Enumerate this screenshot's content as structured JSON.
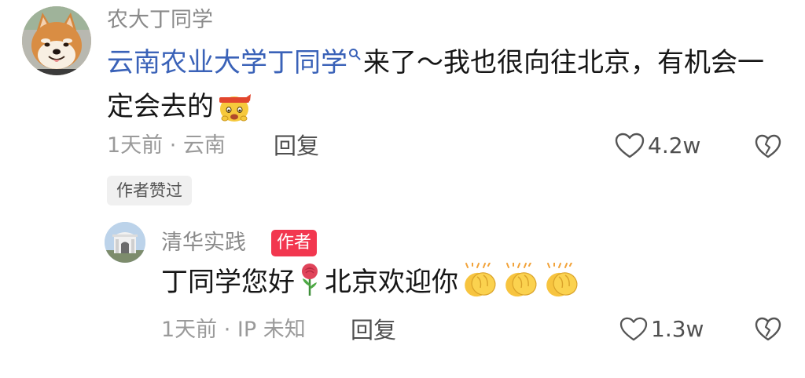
{
  "comment": {
    "username": "农大丁同学",
    "mention_name": "云南农业大学丁同学",
    "text_after_mention": "来了～我也很向往北京，有机会一定会去的",
    "emoji": "emoji-headband-face",
    "time": "1天前 · 云南",
    "reply_label": "回复",
    "like_count": "4.2w",
    "icons": {
      "like": "heart-outline-icon",
      "dislike": "broken-heart-icon",
      "mention": "search-icon"
    },
    "mention_color": "#3a62b8",
    "author_liked_badge": "作者赞过"
  },
  "reply": {
    "username": "清华实践",
    "author_tag": "作者",
    "author_tag_color": "#f2374f",
    "text_part1": "丁同学您好",
    "emoji_rose": "rose-emoji",
    "text_part2": "北京欢迎你",
    "claps": [
      "clapping-hands-emoji",
      "clapping-hands-emoji",
      "clapping-hands-emoji"
    ],
    "time": "1天前 · IP 未知",
    "reply_label": "回复",
    "like_count": "1.3w"
  }
}
